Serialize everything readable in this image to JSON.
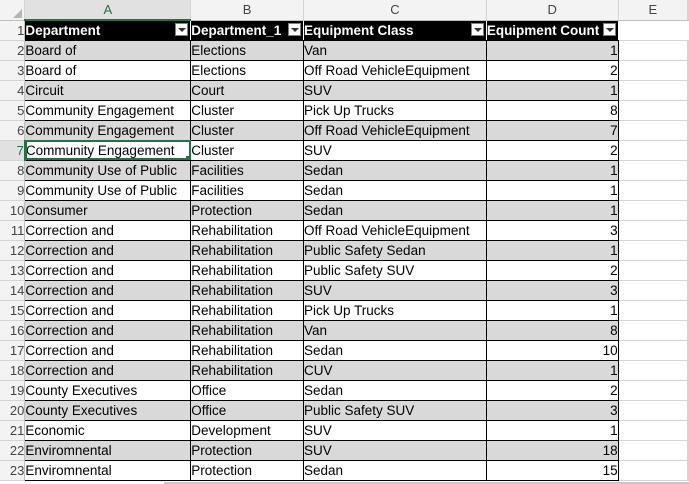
{
  "columns": [
    "A",
    "B",
    "C",
    "D",
    "E"
  ],
  "selected_column": "A",
  "selected_row": 7,
  "headers": [
    "Department",
    "Department_1",
    "Equipment Class",
    "Equipment Count"
  ],
  "rows": [
    {
      "n": 2,
      "a": "Board of",
      "b": "Elections",
      "c": "Van",
      "d": 1
    },
    {
      "n": 3,
      "a": "Board of",
      "b": "Elections",
      "c": "Off Road VehicleEquipment",
      "d": 2
    },
    {
      "n": 4,
      "a": "Circuit",
      "b": "Court",
      "c": "SUV",
      "d": 1
    },
    {
      "n": 5,
      "a": "Community Engagement",
      "b": "Cluster",
      "c": "Pick Up  Trucks",
      "d": 8
    },
    {
      "n": 6,
      "a": "Community Engagement",
      "b": "Cluster",
      "c": "Off Road VehicleEquipment",
      "d": 7
    },
    {
      "n": 7,
      "a": "Community Engagement",
      "b": "Cluster",
      "c": "SUV",
      "d": 2
    },
    {
      "n": 8,
      "a": "Community Use of Public",
      "b": "Facilities",
      "c": "Sedan",
      "d": 1
    },
    {
      "n": 9,
      "a": "Community Use of Public",
      "b": "Facilities",
      "c": "Sedan",
      "d": 1
    },
    {
      "n": 10,
      "a": "Consumer",
      "b": "Protection",
      "c": "Sedan",
      "d": 1
    },
    {
      "n": 11,
      "a": "Correction and",
      "b": "Rehabilitation",
      "c": "Off Road VehicleEquipment",
      "d": 3
    },
    {
      "n": 12,
      "a": "Correction and",
      "b": "Rehabilitation",
      "c": "Public  Safety Sedan",
      "d": 1
    },
    {
      "n": 13,
      "a": "Correction and",
      "b": "Rehabilitation",
      "c": "Public  Safety SUV",
      "d": 2
    },
    {
      "n": 14,
      "a": "Correction and",
      "b": "Rehabilitation",
      "c": "SUV",
      "d": 3
    },
    {
      "n": 15,
      "a": "Correction and",
      "b": "Rehabilitation",
      "c": "Pick Up Trucks",
      "d": 1
    },
    {
      "n": 16,
      "a": "Correction and",
      "b": "Rehabilitation",
      "c": "Van",
      "d": 8
    },
    {
      "n": 17,
      "a": "Correction and",
      "b": "Rehabilitation",
      "c": "Sedan",
      "d": 10
    },
    {
      "n": 18,
      "a": "Correction and",
      "b": "Rehabilitation",
      "c": "CUV",
      "d": 1
    },
    {
      "n": 19,
      "a": "County Executives",
      "b": "Office",
      "c": "Sedan",
      "d": 2
    },
    {
      "n": 20,
      "a": "County Executives",
      "b": "Office",
      "c": "Public Safety SUV",
      "d": 3
    },
    {
      "n": 21,
      "a": "Economic",
      "b": "Development",
      "c": "SUV",
      "d": 1
    },
    {
      "n": 22,
      "a": "Enviromnental",
      "b": "Protection",
      "c": "SUV",
      "d": 18
    },
    {
      "n": 23,
      "a": "Enviromnental",
      "b": "Protection",
      "c": "Sedan",
      "d": 15
    }
  ]
}
